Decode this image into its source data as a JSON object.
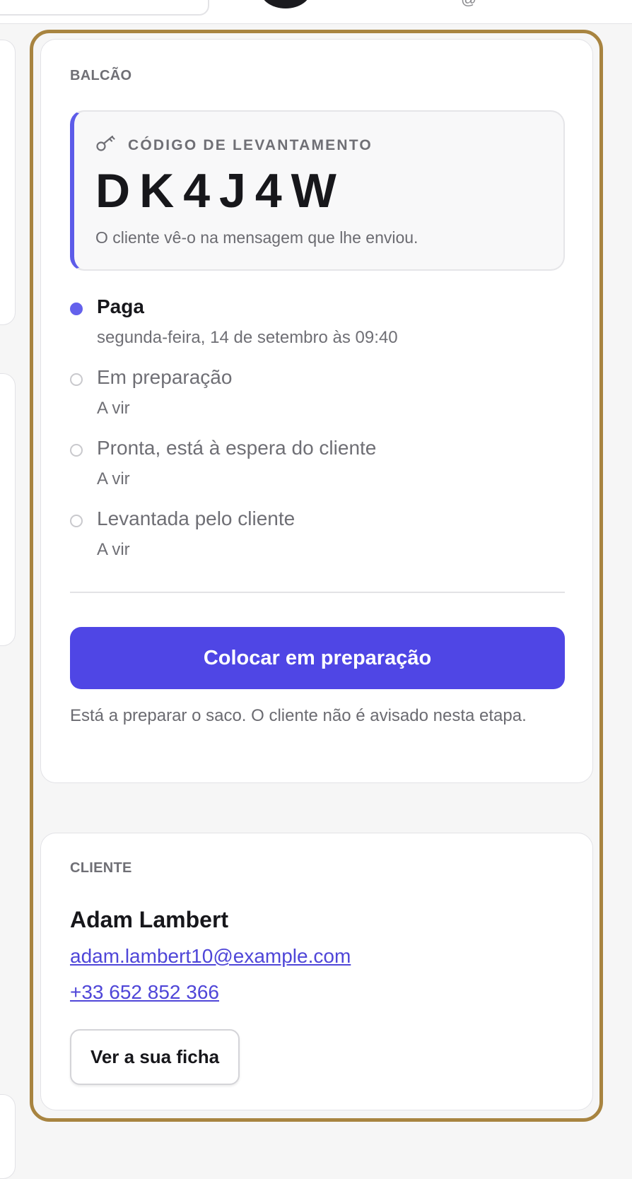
{
  "balcao": {
    "section_label": "BALCÃO",
    "pickup_code": {
      "icon": "key-icon",
      "label": "CÓDIGO DE LEVANTAMENTO",
      "value": "DK4J4W",
      "hint": "O cliente vê-o na mensagem que lhe enviou."
    },
    "timeline": [
      {
        "title": "Paga",
        "subtitle": "segunda-feira, 14 de setembro às 09:40",
        "state": "done"
      },
      {
        "title": "Em preparação",
        "subtitle": "A vir",
        "state": "pending"
      },
      {
        "title": "Pronta, está à espera do cliente",
        "subtitle": "A vir",
        "state": "pending"
      },
      {
        "title": "Levantada pelo cliente",
        "subtitle": "A vir",
        "state": "pending"
      }
    ],
    "action_button_label": "Colocar em preparação",
    "action_note": "Está a preparar o saco. O cliente não é avisado nesta etapa."
  },
  "cliente": {
    "section_label": "CLIENTE",
    "name": "Adam Lambert",
    "email": "adam.lambert10@example.com",
    "phone": "+33 652 852 366",
    "profile_button_label": "Ver a sua ficha"
  },
  "colors": {
    "accent": "#4f46e5",
    "timeline_done": "#6461ec",
    "highlight_frame": "#a88440",
    "link": "#4f46d8"
  }
}
